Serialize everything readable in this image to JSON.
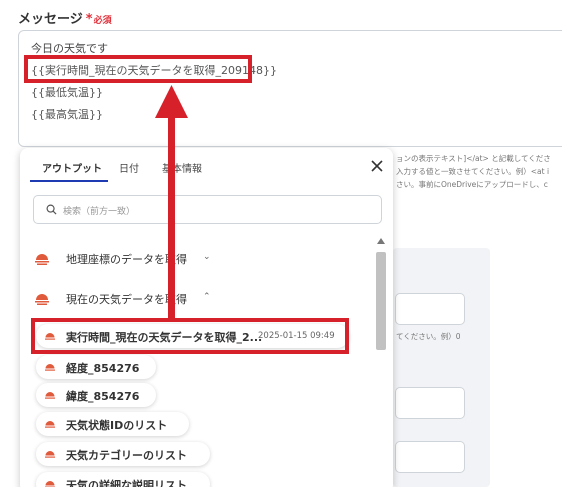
{
  "field": {
    "label": "メッセージ",
    "required_star": "*",
    "required_text": "必須"
  },
  "message": {
    "lines": [
      "今日の天気です",
      "{{実行時間_現在の天気データを取得_209148}}",
      "{{最低気温}}",
      "{{最高気温}}"
    ]
  },
  "background_help": [
    "ョンの表示テキスト]</at> と記載してくださ",
    "入力する値と一致させてください。例）<at i",
    "さい。事前にOneDriveにアップロードし、c",
    "てください。例）0"
  ],
  "popup": {
    "tabs": [
      "アウトプット",
      "日付",
      "基本情報"
    ],
    "close_icon": "close-icon",
    "search_placeholder": "検索（前方一致）",
    "groups": [
      {
        "label": "地理座標のデータを取得",
        "chevron": "down"
      },
      {
        "label": "現在の天気データを取得",
        "chevron": "up"
      }
    ],
    "items": [
      {
        "label": "実行時間_現在の天気データを取得_2...",
        "time": "2025-01-15 09:49"
      },
      {
        "label": "経度_854276"
      },
      {
        "label": "緯度_854276"
      },
      {
        "label": "天気状態IDのリスト"
      },
      {
        "label": "天気カテゴリーのリスト"
      },
      {
        "label": "天気の詳細な説明リスト"
      }
    ]
  },
  "colors": {
    "highlight": "#d6202a",
    "weather_icon": "#e05a3c",
    "tab_underline": "#1f3bb3",
    "required": "#e0303a"
  }
}
